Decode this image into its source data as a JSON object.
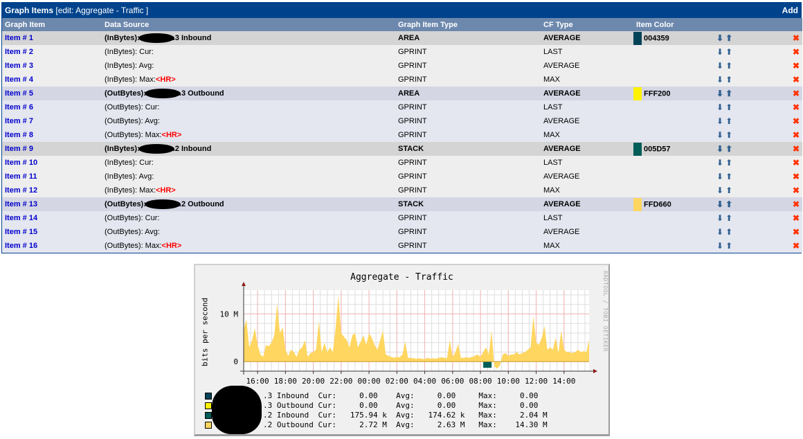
{
  "panel": {
    "title": "Graph Items",
    "subtitle": "[edit: Aggregate - Traffic ]",
    "add_label": "Add",
    "columns": [
      "Graph Item",
      "Data Source",
      "Graph Item Type",
      "CF Type",
      "Item Color"
    ],
    "rows": [
      {
        "item": "Item # 1",
        "ds_prefix": "(InBytes):",
        "ds_suffix": ".3 Inbound",
        "redacted": true,
        "hr": false,
        "type": "AREA",
        "cf": "AVERAGE",
        "color": "004359",
        "header": true,
        "group": 1
      },
      {
        "item": "Item # 2",
        "ds_prefix": "(InBytes): Cur:",
        "ds_suffix": "",
        "redacted": false,
        "hr": false,
        "type": "GPRINT",
        "cf": "LAST",
        "color": "",
        "header": false,
        "group": 1
      },
      {
        "item": "Item # 3",
        "ds_prefix": "(InBytes): Avg:",
        "ds_suffix": "",
        "redacted": false,
        "hr": false,
        "type": "GPRINT",
        "cf": "AVERAGE",
        "color": "",
        "header": false,
        "group": 1
      },
      {
        "item": "Item # 4",
        "ds_prefix": "(InBytes): Max:",
        "ds_suffix": "",
        "redacted": false,
        "hr": true,
        "type": "GPRINT",
        "cf": "MAX",
        "color": "",
        "header": false,
        "group": 1
      },
      {
        "item": "Item # 5",
        "ds_prefix": "(OutBytes):",
        "ds_suffix": ".3 Outbound",
        "redacted": true,
        "hr": false,
        "type": "AREA",
        "cf": "AVERAGE",
        "color": "FFF200",
        "header": true,
        "group": 2
      },
      {
        "item": "Item # 6",
        "ds_prefix": "(OutBytes): Cur:",
        "ds_suffix": "",
        "redacted": false,
        "hr": false,
        "type": "GPRINT",
        "cf": "LAST",
        "color": "",
        "header": false,
        "group": 2
      },
      {
        "item": "Item # 7",
        "ds_prefix": "(OutBytes): Avg:",
        "ds_suffix": "",
        "redacted": false,
        "hr": false,
        "type": "GPRINT",
        "cf": "AVERAGE",
        "color": "",
        "header": false,
        "group": 2
      },
      {
        "item": "Item # 8",
        "ds_prefix": "(OutBytes): Max:",
        "ds_suffix": "",
        "redacted": false,
        "hr": true,
        "type": "GPRINT",
        "cf": "MAX",
        "color": "",
        "header": false,
        "group": 2
      },
      {
        "item": "Item # 9",
        "ds_prefix": "(InBytes):",
        "ds_suffix": ".2 Inbound",
        "redacted": true,
        "hr": false,
        "type": "STACK",
        "cf": "AVERAGE",
        "color": "005D57",
        "header": true,
        "group": 1
      },
      {
        "item": "Item # 10",
        "ds_prefix": "(InBytes): Cur:",
        "ds_suffix": "",
        "redacted": false,
        "hr": false,
        "type": "GPRINT",
        "cf": "LAST",
        "color": "",
        "header": false,
        "group": 1
      },
      {
        "item": "Item # 11",
        "ds_prefix": "(InBytes): Avg:",
        "ds_suffix": "",
        "redacted": false,
        "hr": false,
        "type": "GPRINT",
        "cf": "AVERAGE",
        "color": "",
        "header": false,
        "group": 1
      },
      {
        "item": "Item # 12",
        "ds_prefix": "(InBytes): Max:",
        "ds_suffix": "",
        "redacted": false,
        "hr": true,
        "type": "GPRINT",
        "cf": "MAX",
        "color": "",
        "header": false,
        "group": 1
      },
      {
        "item": "Item # 13",
        "ds_prefix": "(OutBytes):",
        "ds_suffix": ".2 Outbound",
        "redacted": true,
        "hr": false,
        "type": "STACK",
        "cf": "AVERAGE",
        "color": "FFD660",
        "header": true,
        "group": 2
      },
      {
        "item": "Item # 14",
        "ds_prefix": "(OutBytes): Cur:",
        "ds_suffix": "",
        "redacted": false,
        "hr": false,
        "type": "GPRINT",
        "cf": "LAST",
        "color": "",
        "header": false,
        "group": 2
      },
      {
        "item": "Item # 15",
        "ds_prefix": "(OutBytes): Avg:",
        "ds_suffix": "",
        "redacted": false,
        "hr": false,
        "type": "GPRINT",
        "cf": "AVERAGE",
        "color": "",
        "header": false,
        "group": 2
      },
      {
        "item": "Item # 16",
        "ds_prefix": "(OutBytes): Max:",
        "ds_suffix": "",
        "redacted": false,
        "hr": true,
        "type": "GPRINT",
        "cf": "MAX",
        "color": "",
        "header": false,
        "group": 2
      }
    ],
    "hr_label": "<HR>",
    "move_down_icon": "arrow-down-icon",
    "move_up_icon": "arrow-up-icon",
    "delete_icon": "delete-x-icon",
    "delete_glyph": "✖"
  },
  "graph": {
    "title": "Aggregate - Traffic",
    "ylabel": "bits per second",
    "credit": "RRDTOOL / TOBI OETIKER",
    "legend": [
      {
        "color": "#004359",
        "label": ".3 Inbound  ",
        "cur": "     0.00  ",
        "avg": "     0.00  ",
        "max": "     0.00"
      },
      {
        "color": "#FFF200",
        "label": ".3 Outbound ",
        "cur": "     0.00  ",
        "avg": "     0.00  ",
        "max": "     0.00"
      },
      {
        "color": "#005D57",
        "label": ".2 Inbound  ",
        "cur": "   175.94 k",
        "avg": "   174.62 k",
        "max": "     2.04 M"
      },
      {
        "color": "#FFD660",
        "label": ".2 Outbound ",
        "cur": "     2.72 M",
        "avg": "     2.63 M",
        "max": "    14.30 M"
      }
    ],
    "legend_labels": {
      "cur": "Cur:",
      "avg": "Avg:",
      "max": "Max:"
    }
  },
  "chart_data": {
    "type": "area",
    "title": "Aggregate - Traffic",
    "xlabel": "",
    "ylabel": "bits per second",
    "x_ticks": [
      "16:00",
      "18:00",
      "20:00",
      "22:00",
      "00:00",
      "02:00",
      "04:00",
      "06:00",
      "08:00",
      "10:00",
      "12:00",
      "14:00"
    ],
    "y_ticks": [
      {
        "value": 0,
        "label": "0"
      },
      {
        "value": 10,
        "label": "10 M"
      }
    ],
    "ylim": [
      -2,
      15
    ],
    "xlim_hours": [
      15.0,
      39.8
    ],
    "grid": true,
    "series": [
      {
        "name": ".2 Outbound",
        "color": "#FFD660",
        "unit": "M bits/s",
        "x": [
          15.0,
          15.2,
          15.4,
          15.6,
          15.8,
          16.0,
          16.2,
          16.4,
          16.6,
          16.8,
          17.0,
          17.2,
          17.4,
          17.6,
          17.8,
          18.0,
          18.2,
          18.4,
          18.6,
          18.8,
          19.0,
          19.2,
          19.4,
          19.6,
          19.8,
          20.0,
          20.2,
          20.4,
          20.6,
          20.8,
          21.0,
          21.2,
          21.4,
          21.6,
          21.8,
          22.0,
          22.2,
          22.4,
          22.6,
          22.8,
          23.0,
          23.2,
          23.4,
          23.6,
          23.8,
          24.0,
          24.2,
          24.4,
          24.6,
          24.8,
          25.0,
          25.2,
          25.4,
          25.6,
          25.8,
          26.0,
          26.2,
          26.4,
          26.6,
          26.8,
          27.0,
          27.2,
          27.4,
          27.6,
          27.8,
          28.0,
          28.2,
          28.4,
          28.6,
          28.8,
          29.0,
          29.2,
          29.4,
          29.6,
          29.8,
          30.0,
          30.2,
          30.4,
          30.6,
          30.8,
          31.0,
          31.2,
          31.4,
          31.6,
          31.8,
          32.0,
          32.2,
          32.4,
          32.6,
          32.8,
          33.0,
          33.2,
          33.4,
          33.6,
          33.8,
          34.0,
          34.2,
          34.4,
          34.6,
          34.8,
          35.0,
          35.2,
          35.4,
          35.6,
          35.8,
          36.0,
          36.2,
          36.4,
          36.6,
          36.8,
          37.0,
          37.2,
          37.4,
          37.6,
          37.8,
          38.0,
          38.2,
          38.4,
          38.6,
          38.8,
          39.0,
          39.2,
          39.4,
          39.6,
          39.8
        ],
        "values": [
          6.8,
          8.8,
          3.0,
          4.5,
          7.0,
          3.5,
          1.5,
          1.0,
          3.5,
          3.2,
          4.0,
          5.5,
          12.2,
          6.0,
          7.2,
          2.5,
          1.2,
          2.5,
          2.0,
          1.0,
          2.5,
          3.0,
          4.5,
          1.0,
          1.8,
          2.0,
          2.5,
          8.5,
          2.0,
          4.0,
          2.0,
          3.0,
          2.0,
          7.0,
          13.8,
          6.0,
          5.2,
          4.5,
          3.0,
          5.5,
          6.0,
          3.0,
          4.2,
          5.5,
          3.5,
          6.0,
          5.0,
          3.5,
          2.5,
          4.5,
          6.5,
          1.5,
          1.2,
          1.0,
          0.8,
          1.0,
          0.9,
          1.5,
          4.2,
          0.8,
          0.8,
          0.7,
          0.6,
          0.7,
          0.6,
          0.5,
          0.8,
          0.6,
          0.7,
          0.6,
          0.8,
          0.9,
          0.8,
          0.7,
          4.5,
          0.9,
          2.0,
          3.7,
          0.8,
          0.8,
          0.9,
          0.8,
          1.0,
          1.2,
          1.5,
          1.0,
          2.0,
          3.0,
          1.5,
          6.5,
          -1.0,
          -1.5,
          -0.8,
          1.5,
          1.8,
          1.2,
          1.5,
          1.5,
          2.0,
          1.5,
          1.8,
          2.0,
          2.5,
          3.0,
          9.5,
          4.0,
          3.5,
          5.0,
          7.5,
          2.5,
          3.0,
          2.5,
          5.0,
          1.8,
          6.5,
          2.5,
          2.0,
          2.0,
          1.8,
          2.0,
          2.5,
          2.0,
          2.2,
          2.0,
          4.5
        ]
      },
      {
        "name": ".2 Inbound",
        "color": "#005D57",
        "unit": "M bits/s",
        "note": "small negative dip near 08:00 (~ -1.3 M)"
      },
      {
        "name": ".3 Inbound",
        "color": "#004359",
        "unit": "bits/s",
        "note": "all zero"
      },
      {
        "name": ".3 Outbound",
        "color": "#FFF200",
        "unit": "bits/s",
        "note": "all zero"
      }
    ]
  }
}
